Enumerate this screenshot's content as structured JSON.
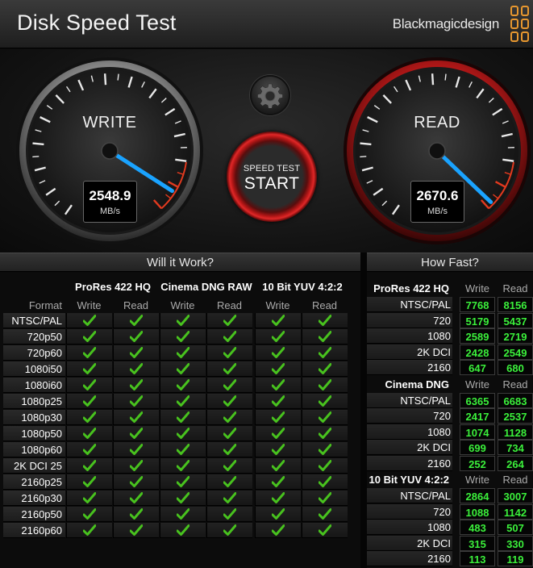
{
  "app": {
    "title": "Disk Speed Test",
    "brand": "Blackmagicdesign"
  },
  "colors": {
    "accent_blue": "#1aa3ff",
    "check_green": "#48c21e",
    "value_green": "#3bf03b",
    "logo_orange": "#e7972f",
    "read_red": "#c41a1a"
  },
  "write_gauge": {
    "label": "WRITE",
    "value": "2548.9",
    "unit": "MB/s",
    "needle_fraction": 0.98
  },
  "read_gauge": {
    "label": "READ",
    "value": "2670.6",
    "unit": "MB/s",
    "needle_fraction": 1.02
  },
  "start_button": {
    "caption": "SPEED TEST",
    "label": "START"
  },
  "settings_button": {
    "icon": "gear-icon"
  },
  "will_it_work": {
    "header": "Will it Work?",
    "format_header": "Format",
    "codecs": [
      "ProRes 422 HQ",
      "Cinema DNG RAW",
      "10 Bit YUV 4:2:2"
    ],
    "sub_headers": [
      "Write",
      "Read",
      "Write",
      "Read",
      "Write",
      "Read"
    ],
    "formats": [
      "NTSC/PAL",
      "720p50",
      "720p60",
      "1080i50",
      "1080i60",
      "1080p25",
      "1080p30",
      "1080p50",
      "1080p60",
      "2K DCI 25",
      "2160p25",
      "2160p30",
      "2160p50",
      "2160p60"
    ]
  },
  "how_fast": {
    "header": "How Fast?",
    "write_label": "Write",
    "read_label": "Read",
    "groups": [
      {
        "codec": "ProRes 422 HQ",
        "rows": [
          {
            "format": "NTSC/PAL",
            "write": "7768",
            "read": "8156"
          },
          {
            "format": "720",
            "write": "5179",
            "read": "5437"
          },
          {
            "format": "1080",
            "write": "2589",
            "read": "2719"
          },
          {
            "format": "2K DCI",
            "write": "2428",
            "read": "2549"
          },
          {
            "format": "2160",
            "write": "647",
            "read": "680"
          }
        ]
      },
      {
        "codec": "Cinema DNG RAW",
        "rows": [
          {
            "format": "NTSC/PAL",
            "write": "6365",
            "read": "6683"
          },
          {
            "format": "720",
            "write": "2417",
            "read": "2537"
          },
          {
            "format": "1080",
            "write": "1074",
            "read": "1128"
          },
          {
            "format": "2K DCI",
            "write": "699",
            "read": "734"
          },
          {
            "format": "2160",
            "write": "252",
            "read": "264"
          }
        ]
      },
      {
        "codec": "10 Bit YUV 4:2:2",
        "rows": [
          {
            "format": "NTSC/PAL",
            "write": "2864",
            "read": "3007"
          },
          {
            "format": "720",
            "write": "1088",
            "read": "1142"
          },
          {
            "format": "1080",
            "write": "483",
            "read": "507"
          },
          {
            "format": "2K DCI",
            "write": "315",
            "read": "330"
          },
          {
            "format": "2160",
            "write": "113",
            "read": "119"
          }
        ]
      }
    ]
  }
}
